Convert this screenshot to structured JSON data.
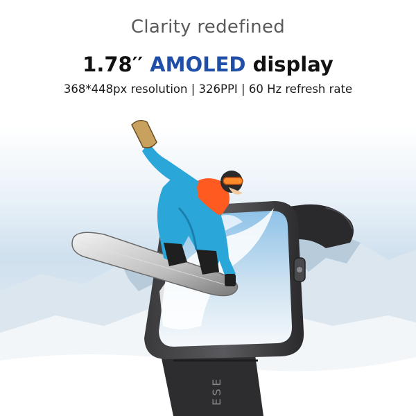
{
  "tagline": "Clarity redefined",
  "headline": {
    "size": "1.78′′",
    "highlight": "AMOLED",
    "suffix": "display"
  },
  "specs": "368*448px resolution | 326PPI | 60 Hz refresh rate",
  "strap_text": "ESE",
  "colors": {
    "accent": "#1f4fa8",
    "tagline": "#5a5a5a",
    "title": "#111111",
    "jacket": "#2aa6d9",
    "vest": "#ff5a1f"
  }
}
